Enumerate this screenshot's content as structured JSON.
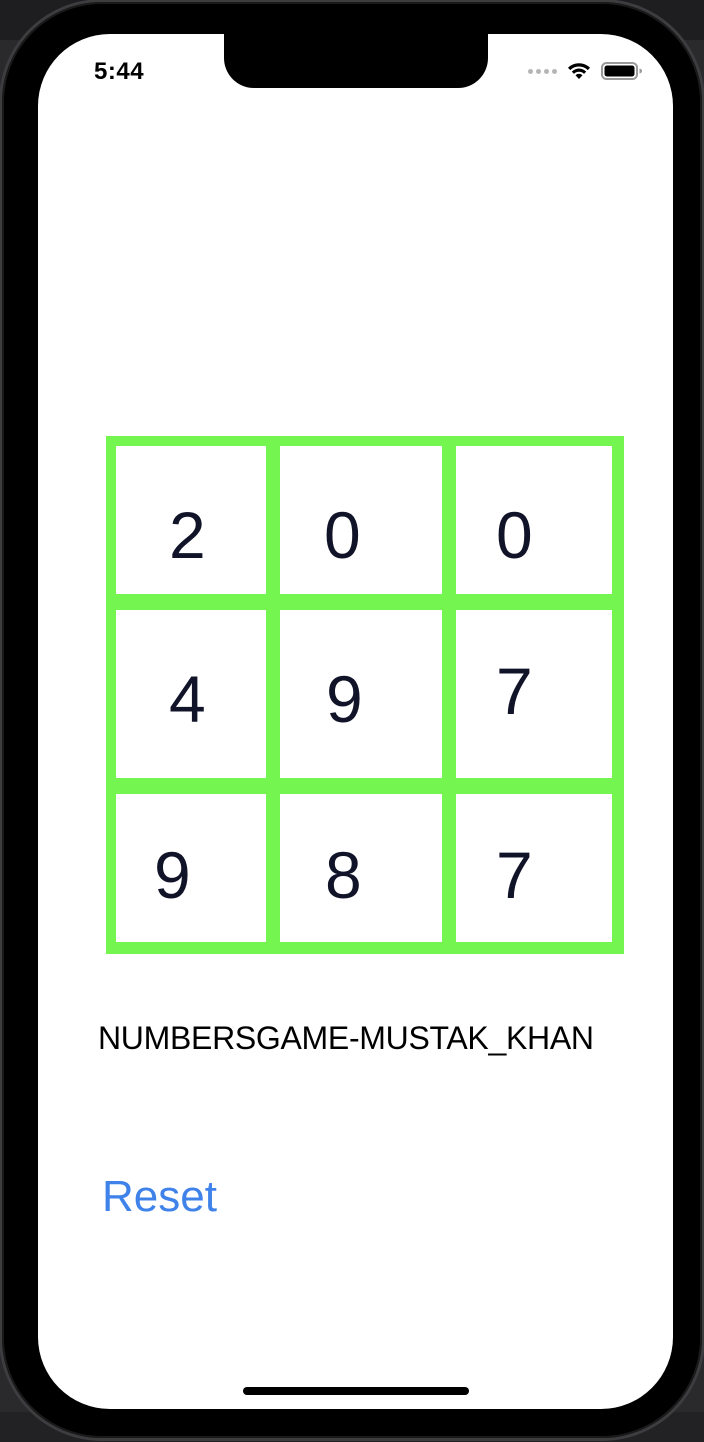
{
  "status_bar": {
    "time": "5:44"
  },
  "grid": {
    "cells": [
      [
        "2",
        "0",
        "0"
      ],
      [
        "4",
        "9",
        "7"
      ],
      [
        "9",
        "8",
        "7"
      ]
    ]
  },
  "title": "NUMBERSGAME-MUSTAK_KHAN",
  "reset_label": "Reset",
  "colors": {
    "grid_border": "#74f54f",
    "reset_text": "#3e82ea",
    "digit_text": "#111428"
  },
  "icons": [
    "wifi-icon",
    "battery-icon",
    "cellular-signal-icon"
  ]
}
